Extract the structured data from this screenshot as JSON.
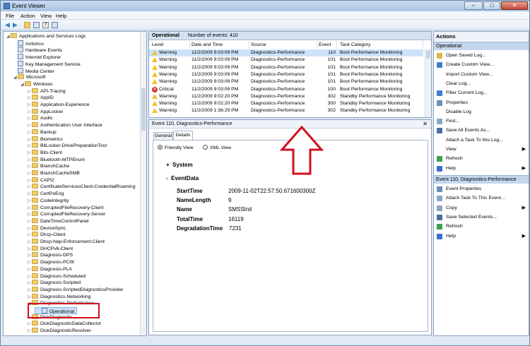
{
  "window": {
    "title": "Event Viewer",
    "controls": [
      "–",
      "□",
      "✕"
    ]
  },
  "menu": [
    "File",
    "Action",
    "View",
    "Help"
  ],
  "tree": {
    "items": [
      {
        "label": "Applications and Services Logs",
        "level": 0,
        "type": "folder",
        "arrow": "◢"
      },
      {
        "label": "Antivirus",
        "level": 1,
        "type": "log"
      },
      {
        "label": "Hardware Events",
        "level": 1,
        "type": "log"
      },
      {
        "label": "Internet Explorer",
        "level": 1,
        "type": "log"
      },
      {
        "label": "Key Management Service",
        "level": 1,
        "type": "log"
      },
      {
        "label": "Media Center",
        "level": 1,
        "type": "log"
      },
      {
        "label": "Microsoft",
        "level": 1,
        "type": "folder",
        "arrow": "◢"
      },
      {
        "label": "Windows",
        "level": 2,
        "type": "folder",
        "arrow": "◢"
      },
      {
        "label": "API-Tracing",
        "level": 3,
        "type": "folder",
        "arrow": "▷"
      },
      {
        "label": "AppID",
        "level": 3,
        "type": "folder",
        "arrow": "▷"
      },
      {
        "label": "Application-Experience",
        "level": 3,
        "type": "folder",
        "arrow": "▷"
      },
      {
        "label": "AppLocker",
        "level": 3,
        "type": "folder",
        "arrow": "▷"
      },
      {
        "label": "Audio",
        "level": 3,
        "type": "folder",
        "arrow": "▷"
      },
      {
        "label": "Authentication User Interface",
        "level": 3,
        "type": "folder",
        "arrow": "▷"
      },
      {
        "label": "Backup",
        "level": 3,
        "type": "folder",
        "arrow": "▷"
      },
      {
        "label": "Biometrics",
        "level": 3,
        "type": "folder",
        "arrow": "▷"
      },
      {
        "label": "BitLocker-DrivePreparationTool",
        "level": 3,
        "type": "folder",
        "arrow": "▷"
      },
      {
        "label": "Bits-Client",
        "level": 3,
        "type": "folder",
        "arrow": "▷"
      },
      {
        "label": "Bluetooth-MTPEnum",
        "level": 3,
        "type": "folder",
        "arrow": "▷"
      },
      {
        "label": "BranchCache",
        "level": 3,
        "type": "folder",
        "arrow": "▷"
      },
      {
        "label": "BranchCacheSMB",
        "level": 3,
        "type": "folder",
        "arrow": "▷"
      },
      {
        "label": "CAPI2",
        "level": 3,
        "type": "folder",
        "arrow": "▷"
      },
      {
        "label": "CertificateServicesClient-CredentialRoaming",
        "level": 3,
        "type": "folder",
        "arrow": "▷"
      },
      {
        "label": "CertPoEng",
        "level": 3,
        "type": "folder",
        "arrow": "▷"
      },
      {
        "label": "CodeIntegrity",
        "level": 3,
        "type": "folder",
        "arrow": "▷"
      },
      {
        "label": "CorruptedFileRecovery-Client",
        "level": 3,
        "type": "folder",
        "arrow": "▷"
      },
      {
        "label": "CorruptedFileRecovery-Server",
        "level": 3,
        "type": "folder",
        "arrow": "▷"
      },
      {
        "label": "DateTimeControlPanel",
        "level": 3,
        "type": "folder",
        "arrow": "▷"
      },
      {
        "label": "DeviceSync",
        "level": 3,
        "type": "folder",
        "arrow": "▷"
      },
      {
        "label": "Dhcp-Client",
        "level": 3,
        "type": "folder",
        "arrow": "▷"
      },
      {
        "label": "Dhcp-Nap-Enforcement-Client",
        "level": 3,
        "type": "folder",
        "arrow": "▷"
      },
      {
        "label": "DHCPv6-Client",
        "level": 3,
        "type": "folder",
        "arrow": "▷"
      },
      {
        "label": "Diagnosis-DPS",
        "level": 3,
        "type": "folder",
        "arrow": "▷"
      },
      {
        "label": "Diagnosis-PCW",
        "level": 3,
        "type": "folder",
        "arrow": "▷"
      },
      {
        "label": "Diagnosis-PLA",
        "level": 3,
        "type": "folder",
        "arrow": "▷"
      },
      {
        "label": "Diagnosis-Scheduled",
        "level": 3,
        "type": "folder",
        "arrow": "▷"
      },
      {
        "label": "Diagnosis-Scripted",
        "level": 3,
        "type": "folder",
        "arrow": "▷"
      },
      {
        "label": "Diagnosis-ScriptedDiagnosticsProvider",
        "level": 3,
        "type": "folder",
        "arrow": "▷"
      },
      {
        "label": "Diagnostics-Networking",
        "level": 3,
        "type": "folder",
        "arrow": "▷"
      },
      {
        "label": "Diagnostics-Performance",
        "level": 3,
        "type": "folder",
        "arrow": "◢"
      },
      {
        "label": "Operational",
        "level": 4,
        "type": "log",
        "selected": true
      },
      {
        "label": "DiskDiagnostic",
        "level": 3,
        "type": "folder",
        "arrow": "▷"
      },
      {
        "label": "DiskDiagnosticDataCollector",
        "level": 3,
        "type": "folder",
        "arrow": "▷"
      },
      {
        "label": "DiskDiagnosticResolver",
        "level": 3,
        "type": "folder",
        "arrow": "▷"
      }
    ]
  },
  "events": {
    "log_name": "Operational",
    "count_text": "Number of events: 410",
    "columns": [
      "Level",
      "Date and Time",
      "Source",
      "Event ID",
      "Task Category"
    ],
    "rows": [
      {
        "level": "Warning",
        "icon": "warn",
        "date": "11/2/2009 9:03:09 PM",
        "source": "Diagnostics-Performance",
        "id": "110",
        "task": "Boot Performance Monitoring",
        "selected": true
      },
      {
        "level": "Warning",
        "icon": "warn",
        "date": "11/2/2009 9:03:09 PM",
        "source": "Diagnostics-Performance",
        "id": "101",
        "task": "Boot Performance Monitoring"
      },
      {
        "level": "Warning",
        "icon": "warn",
        "date": "11/2/2009 9:03:09 PM",
        "source": "Diagnostics-Performance",
        "id": "101",
        "task": "Boot Performance Monitoring"
      },
      {
        "level": "Warning",
        "icon": "warn",
        "date": "11/2/2009 9:03:09 PM",
        "source": "Diagnostics-Performance",
        "id": "101",
        "task": "Boot Performance Monitoring"
      },
      {
        "level": "Warning",
        "icon": "warn",
        "date": "11/2/2009 9:03:09 PM",
        "source": "Diagnostics-Performance",
        "id": "101",
        "task": "Boot Performance Monitoring"
      },
      {
        "level": "Critical",
        "icon": "crit",
        "date": "11/2/2009 9:03:09 PM",
        "source": "Diagnostics-Performance",
        "id": "100",
        "task": "Boot Performance Monitoring"
      },
      {
        "level": "Warning",
        "icon": "warn",
        "date": "11/2/2009 9:02:20 PM",
        "source": "Diagnostics-Performance",
        "id": "302",
        "task": "Standby Performance Monitoring"
      },
      {
        "level": "Warning",
        "icon": "warn",
        "date": "11/2/2009 9:02:20 PM",
        "source": "Diagnostics-Performance",
        "id": "300",
        "task": "Standby Performance Monitoring"
      },
      {
        "level": "Warning",
        "icon": "warn",
        "date": "11/2/2009 1:36:29 PM",
        "source": "Diagnostics-Performance",
        "id": "302",
        "task": "Standby Performance Monitoring"
      }
    ]
  },
  "detail": {
    "title": "Event 110, Diagnostics-Performance",
    "tabs": [
      "General",
      "Details"
    ],
    "view_options": [
      "Friendly View",
      "XML View"
    ],
    "sections": [
      {
        "sign": "+",
        "label": "System"
      },
      {
        "sign": "-",
        "label": "EventData"
      }
    ],
    "fields": [
      {
        "key": "StartTime",
        "value": "2009-11-02T22:57:50.671600300Z"
      },
      {
        "key": "NameLength",
        "value": "9"
      },
      {
        "key": "Name",
        "value": "SMSSInit"
      },
      {
        "key": "TotalTime",
        "value": "16119"
      },
      {
        "key": "DegradationTime",
        "value": "7231"
      }
    ]
  },
  "actions": {
    "title": "Actions",
    "section1": "Operational",
    "items1": [
      {
        "label": "Open Saved Log...",
        "color": "#e0b645"
      },
      {
        "label": "Create Custom View...",
        "color": "#3a7fd0"
      },
      {
        "label": "Import Custom View...",
        "color": ""
      },
      {
        "label": "Clear Log...",
        "color": ""
      },
      {
        "label": "Filter Current Log...",
        "color": "#3a7fd0"
      },
      {
        "label": "Properties",
        "color": "#6a8fb8"
      },
      {
        "label": "Disable Log",
        "color": ""
      },
      {
        "label": "Find...",
        "color": "#8aa5c5"
      },
      {
        "label": "Save All Events As...",
        "color": "#4a6fa0"
      },
      {
        "label": "Attach a Task To this Log...",
        "color": ""
      },
      {
        "label": "View",
        "color": "",
        "submenu": true
      },
      {
        "label": "Refresh",
        "color": "#3aa04a"
      },
      {
        "label": "Help",
        "color": "#3a6fd0",
        "submenu": true
      }
    ],
    "section2": "Event 110, Diagnostics-Performance",
    "items2": [
      {
        "label": "Event Properties",
        "color": "#6a8fb8"
      },
      {
        "label": "Attach Task To This Event...",
        "color": "#8aa5c5"
      },
      {
        "label": "Copy",
        "color": "#8aa5c5",
        "submenu": true
      },
      {
        "label": "Save Selected Events...",
        "color": "#4a6fa0"
      },
      {
        "label": "Refresh",
        "color": "#3aa04a"
      },
      {
        "label": "Help",
        "color": "#3a6fd0",
        "submenu": true
      }
    ]
  },
  "colors": {
    "highlight_box": "#d0101e",
    "arrow": "#d0101e",
    "selection": "#cde3fb"
  }
}
